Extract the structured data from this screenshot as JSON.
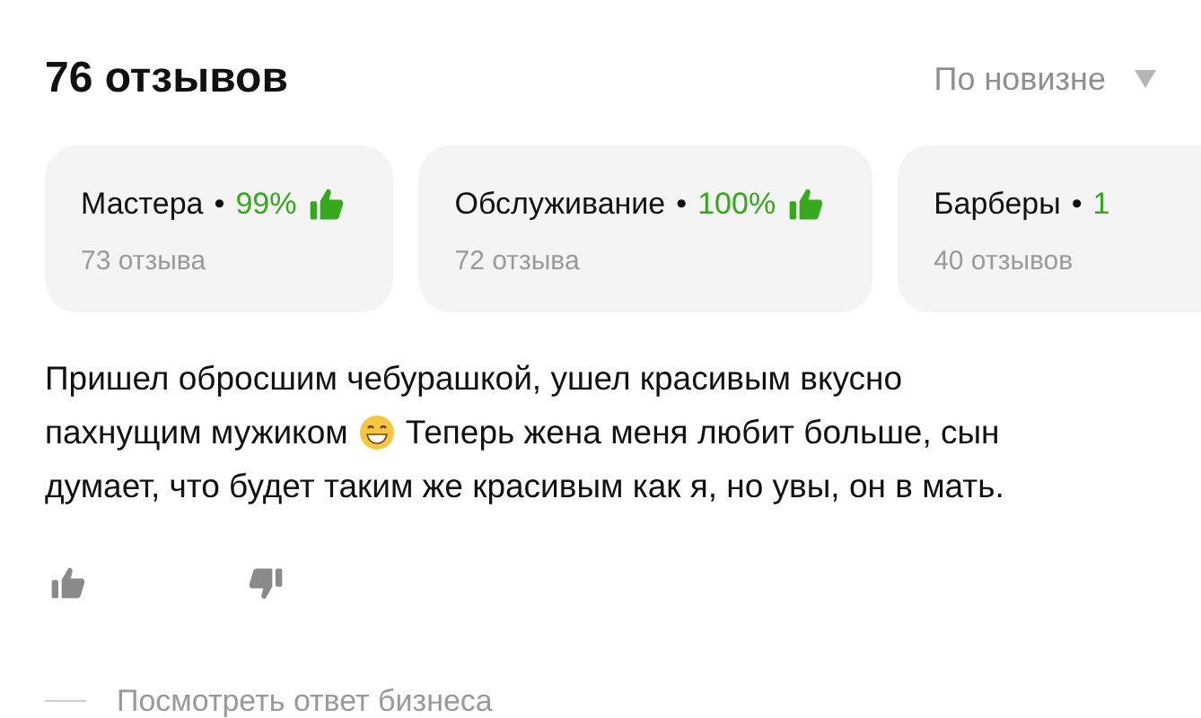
{
  "header": {
    "title": "76 отзывов",
    "sort": "По новизне"
  },
  "categories": [
    {
      "name": "Мастера",
      "separator": "•",
      "percent": "99%",
      "count": "73 отзыва",
      "thumb": true
    },
    {
      "name": "Обслуживание",
      "separator": "•",
      "percent": "100%",
      "count": "72 отзыва",
      "thumb": true
    },
    {
      "name": "Барберы",
      "separator": "•",
      "percent": "1",
      "count": "40 отзывов",
      "thumb": false
    }
  ],
  "review": {
    "lines": [
      [
        {
          "kind": "text",
          "text": "Пришел обросшим чебурашкой, ушел красивым вкусно"
        }
      ],
      [
        {
          "kind": "text",
          "text": "пахнущим мужиком"
        },
        {
          "kind": "emoji"
        },
        {
          "kind": "text",
          "text": "Теперь жена меня любит больше, сын"
        }
      ],
      [
        {
          "kind": "text",
          "text": "думает, что будет таким же красивым как я, но увы, он в мать."
        }
      ]
    ]
  },
  "business_reply": {
    "link": "Посмотреть ответ бизнеса"
  }
}
